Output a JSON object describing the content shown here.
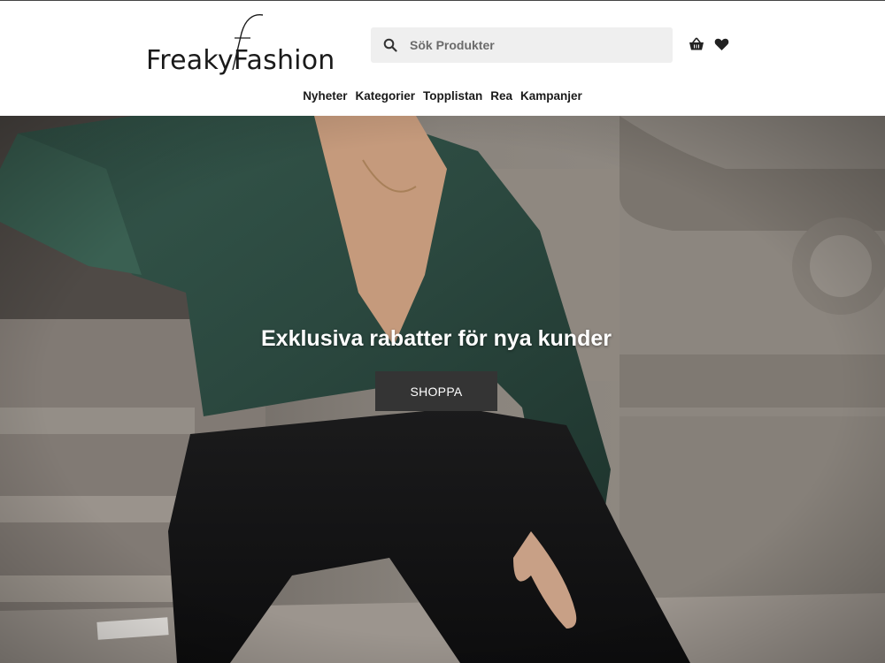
{
  "brand": {
    "name": "FreakyFashion",
    "color": "#1a1a1a"
  },
  "search": {
    "placeholder": "Sök Produkter",
    "value": "",
    "icon": "search-icon"
  },
  "actions": [
    {
      "name": "cart",
      "icon": "shopping-basket-icon"
    },
    {
      "name": "favorites",
      "icon": "heart-icon"
    }
  ],
  "nav": {
    "items": [
      "Nyheter",
      "Kategorier",
      "Topplistan",
      "Rea",
      "Kampanjer"
    ]
  },
  "hero": {
    "title": "Exklusiva rabatter för nya kunder",
    "button_label": "SHOPPA",
    "button_color": "#343434"
  }
}
